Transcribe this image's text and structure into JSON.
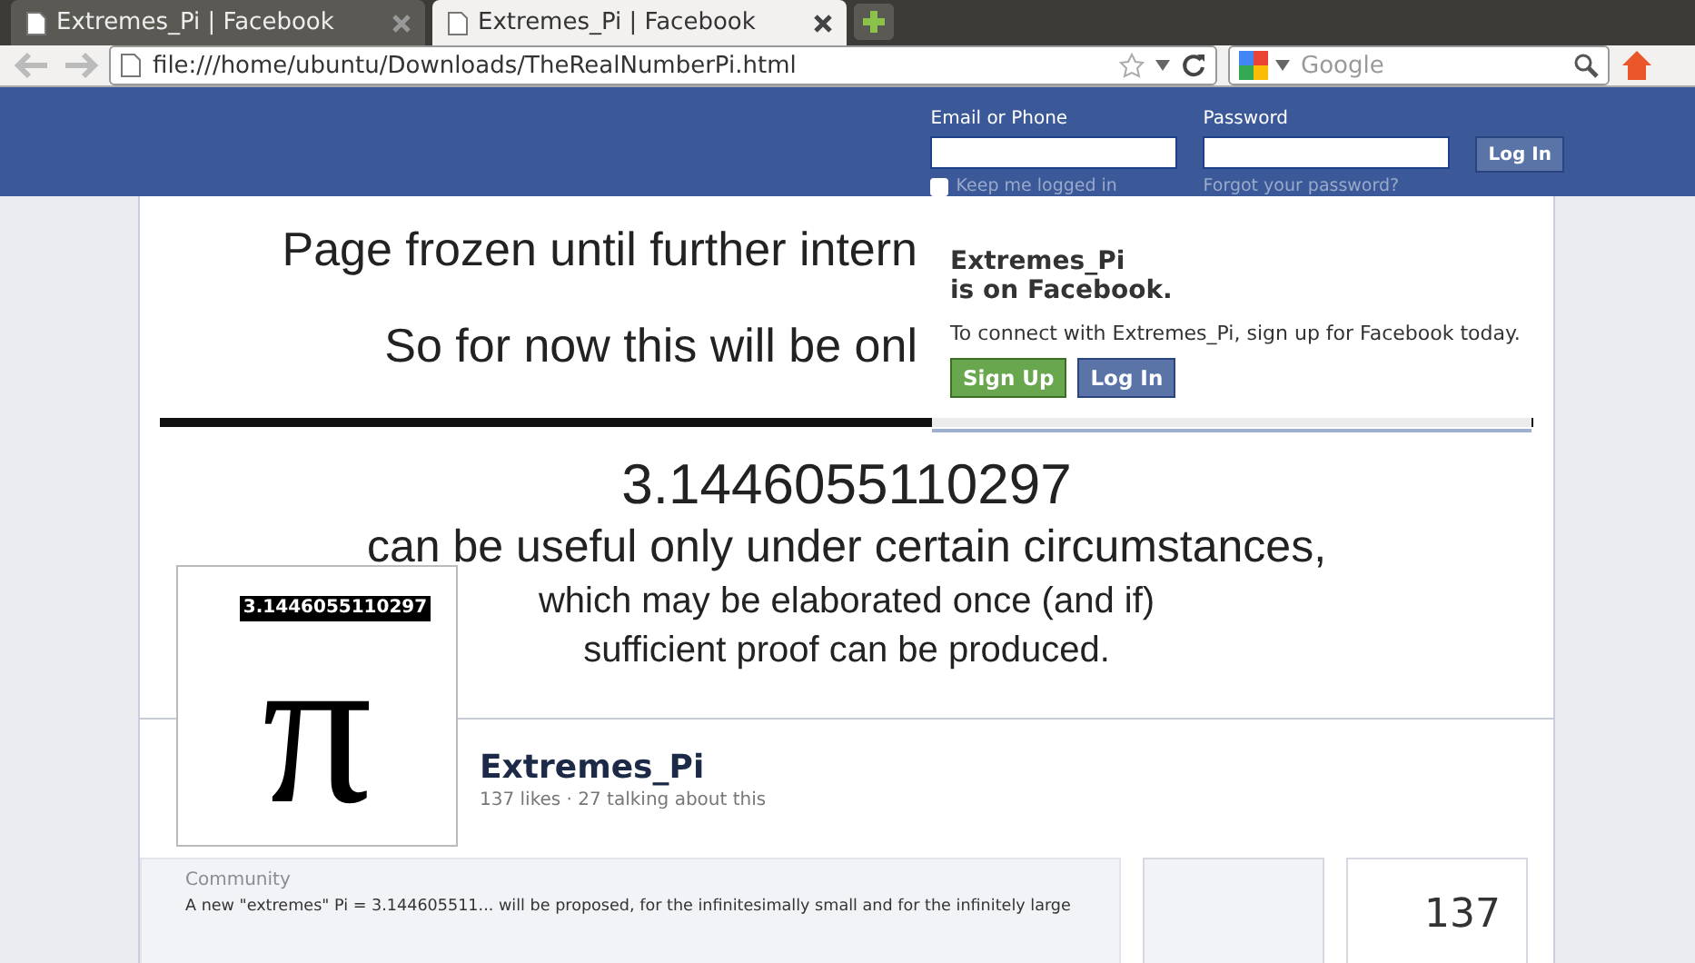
{
  "browser": {
    "tabs": [
      {
        "title": "Extremes_Pi | Facebook",
        "selected": false
      },
      {
        "title": "Extremes_Pi | Facebook",
        "selected": true
      }
    ],
    "address": "file:///home/ubuntu/Downloads/TheRealNumberPi.html",
    "search": {
      "placeholder": "Google"
    }
  },
  "login": {
    "email_label": "Email or Phone",
    "password_label": "Password",
    "button": "Log In",
    "keep_logged_in": {
      "label": "Keep me logged in",
      "checked": false
    },
    "forgot": "Forgot your password?"
  },
  "cover": {
    "lines": [
      "Page frozen until further intern",
      "So for now this will be onl"
    ],
    "number": "3.1446055110297",
    "sentence": "can be useful only under certain circumstances,",
    "notes": [
      "which may be elaborated once (and if)",
      "sufficient proof can be produced."
    ]
  },
  "popup": {
    "title_1": "Extremes_Pi",
    "title_2": "is on Facebook.",
    "text": "To connect with Extremes_Pi, sign up for Facebook today.",
    "buttons": [
      {
        "label": "Sign Up",
        "kind": "signup"
      },
      {
        "label": "Log In",
        "kind": "login"
      }
    ]
  },
  "profile": {
    "logo_glyph": "π",
    "logo_number": "3.1446055110297",
    "name": "Extremes_Pi",
    "stats": "137 likes · 27 talking about this"
  },
  "about": {
    "category": "Community",
    "text": "A new \"extremes\" Pi = 3.144605511... will be proposed, for the infinitesimally small and for the infinitely large"
  },
  "likes_count": "137"
}
